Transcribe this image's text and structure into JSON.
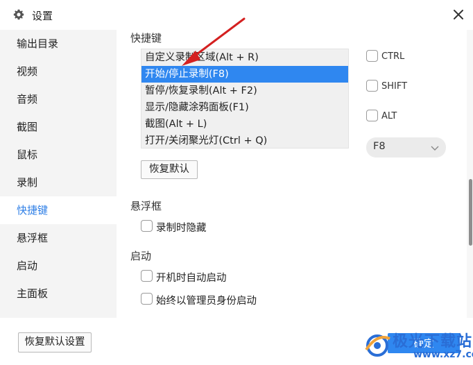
{
  "window": {
    "title": "设置",
    "icons": {
      "title": "gear-icon",
      "close": "close-icon"
    }
  },
  "sidebar": {
    "items": [
      {
        "label": "输出目录"
      },
      {
        "label": "视频"
      },
      {
        "label": "音频"
      },
      {
        "label": "截图"
      },
      {
        "label": "鼠标"
      },
      {
        "label": "录制"
      },
      {
        "label": "快捷键",
        "active": true
      },
      {
        "label": "悬浮框"
      },
      {
        "label": "启动"
      },
      {
        "label": "主面板"
      }
    ]
  },
  "hotkeys": {
    "section_label": "快捷键",
    "items": [
      {
        "label": "自定义录制区域(Alt + R)"
      },
      {
        "label": "开始/停止录制(F8)",
        "selected": true
      },
      {
        "label": "暂停/恢复录制(Alt + F2)"
      },
      {
        "label": "显示/隐藏涂鸦面板(F1)"
      },
      {
        "label": "截图(Alt + L)"
      },
      {
        "label": "打开/关闭聚光灯(Ctrl + Q)"
      }
    ],
    "modifiers": [
      {
        "label": "CTRL",
        "checked": false
      },
      {
        "label": "SHIFT",
        "checked": false
      },
      {
        "label": "ALT",
        "checked": false
      }
    ],
    "key_select": {
      "value": "F8"
    },
    "restore_default_label": "恢复默认"
  },
  "floating": {
    "section_label": "悬浮框",
    "options": [
      {
        "label": "录制时隐藏",
        "checked": false
      }
    ]
  },
  "startup": {
    "section_label": "启动",
    "options": [
      {
        "label": "开机时自动启动",
        "checked": false
      },
      {
        "label": "始终以管理员身份启动",
        "checked": false
      }
    ]
  },
  "footer": {
    "restore_all_label": "恢复默认设置",
    "ok_label": "确定"
  },
  "watermark": {
    "name": "极光下载站",
    "url": "www.xz7.com"
  },
  "colors": {
    "accent": "#2f87f0",
    "active_nav_text": "#2f7fe6",
    "sidebar_bg": "#f4f4f4",
    "annotation_arrow": "#d42020"
  }
}
